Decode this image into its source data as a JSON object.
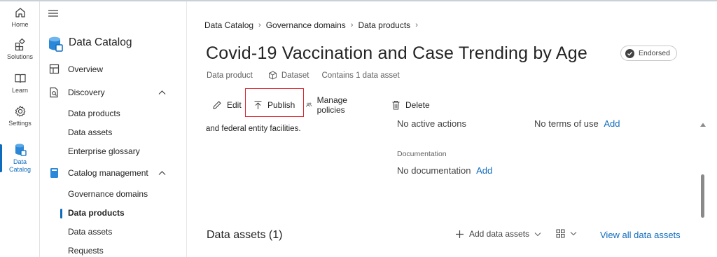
{
  "rail": {
    "items": [
      {
        "label": "Home",
        "icon": "home-icon"
      },
      {
        "label": "Solutions",
        "icon": "solutions-icon"
      },
      {
        "label": "Learn",
        "icon": "book-icon"
      },
      {
        "label": "Settings",
        "icon": "gear-icon"
      },
      {
        "label_line1": "Data",
        "label_line2": "Catalog",
        "icon": "data-catalog-icon"
      }
    ]
  },
  "nav": {
    "title": "Data Catalog",
    "overview": "Overview",
    "discovery": "Discovery",
    "discovery_items": [
      "Data products",
      "Data assets",
      "Enterprise glossary"
    ],
    "catalog_management": "Catalog management",
    "catalog_items": [
      "Governance domains",
      "Data products",
      "Data assets",
      "Requests"
    ]
  },
  "breadcrumb": [
    "Data Catalog",
    "Governance domains",
    "Data products"
  ],
  "page": {
    "title": "Covid-19 Vaccination and Case Trending by Age",
    "badge": "Endorsed",
    "meta": {
      "type": "Data product",
      "dataset": "Dataset",
      "contains": "Contains 1 data asset"
    }
  },
  "toolbar": {
    "edit": "Edit",
    "publish": "Publish",
    "manage_policies": "Manage policies",
    "delete": "Delete"
  },
  "details": {
    "description_fragment": "and federal entity facilities.",
    "no_active_actions": "No active actions",
    "no_terms": "No terms of use",
    "add_terms": "Add",
    "documentation_label": "Documentation",
    "no_documentation": "No documentation",
    "add_documentation": "Add"
  },
  "data_assets": {
    "title": "Data assets (1)",
    "add_label": "Add data assets",
    "view_all": "View all data assets"
  },
  "colors": {
    "accent": "#0f6cbd",
    "highlight": "#d9252f"
  }
}
